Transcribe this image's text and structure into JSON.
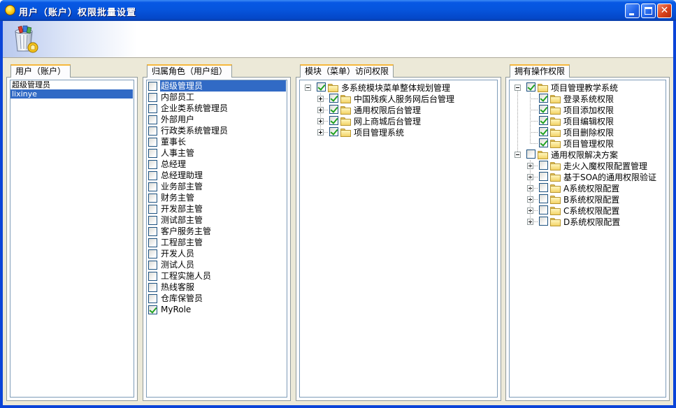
{
  "window": {
    "title": "用户（账户）权限批量设置",
    "controls": {
      "minimize": "minimize",
      "maximize": "maximize",
      "close": "✕"
    }
  },
  "toolbar": {
    "icon": "recycle-bin-icon"
  },
  "panels": {
    "users": {
      "tab": "用户（账户）",
      "items": [
        {
          "label": "超级管理员",
          "selected": false
        },
        {
          "label": "lixinye",
          "selected": true
        }
      ]
    },
    "roles": {
      "tab": "归属角色（用户组）",
      "items": [
        {
          "label": "超级管理员",
          "checked": false,
          "selected": true
        },
        {
          "label": "内部员工",
          "checked": false
        },
        {
          "label": "企业类系统管理员",
          "checked": false
        },
        {
          "label": "外部用户",
          "checked": false
        },
        {
          "label": "行政类系统管理员",
          "checked": false
        },
        {
          "label": "董事长",
          "checked": false
        },
        {
          "label": "人事主管",
          "checked": false
        },
        {
          "label": "总经理",
          "checked": false
        },
        {
          "label": "总经理助理",
          "checked": false
        },
        {
          "label": "业务部主管",
          "checked": false
        },
        {
          "label": "财务主管",
          "checked": false
        },
        {
          "label": "开发部主管",
          "checked": false
        },
        {
          "label": "测试部主管",
          "checked": false
        },
        {
          "label": "客户服务主管",
          "checked": false
        },
        {
          "label": "工程部主管",
          "checked": false
        },
        {
          "label": "开发人员",
          "checked": false
        },
        {
          "label": "测试人员",
          "checked": false
        },
        {
          "label": "工程实施人员",
          "checked": false
        },
        {
          "label": "热线客服",
          "checked": false
        },
        {
          "label": "仓库保管员",
          "checked": false
        },
        {
          "label": "MyRole",
          "checked": true
        }
      ]
    },
    "modules": {
      "tab": "模块（菜单）访问权限",
      "root": {
        "label": "多系统模块菜单整体规划管理",
        "checked": true,
        "expanded": true
      },
      "children": [
        {
          "label": "中国残疾人服务网后台管理",
          "checked": true
        },
        {
          "label": "通用权限后台管理",
          "checked": true
        },
        {
          "label": "网上商城后台管理",
          "checked": true
        },
        {
          "label": "项目管理系统",
          "checked": true
        }
      ]
    },
    "operations": {
      "tab": "拥有操作权限",
      "groups": [
        {
          "label": "项目管理教学系统",
          "checked": true,
          "expanded": true,
          "children": [
            {
              "label": "登录系统权限",
              "checked": true
            },
            {
              "label": "项目添加权限",
              "checked": true
            },
            {
              "label": "项目编辑权限",
              "checked": true
            },
            {
              "label": "项目删除权限",
              "checked": true
            },
            {
              "label": "项目管理权限",
              "checked": true
            }
          ]
        },
        {
          "label": "通用权限解决方案",
          "checked": false,
          "expanded": true,
          "children": [
            {
              "label": "走火入魔权限配置管理",
              "checked": false
            },
            {
              "label": "基于SOA的通用权限验证",
              "checked": false
            },
            {
              "label": "A系统权限配置",
              "checked": false
            },
            {
              "label": "B系统权限配置",
              "checked": false
            },
            {
              "label": "C系统权限配置",
              "checked": false
            },
            {
              "label": "D系统权限配置",
              "checked": false
            }
          ]
        }
      ]
    }
  }
}
